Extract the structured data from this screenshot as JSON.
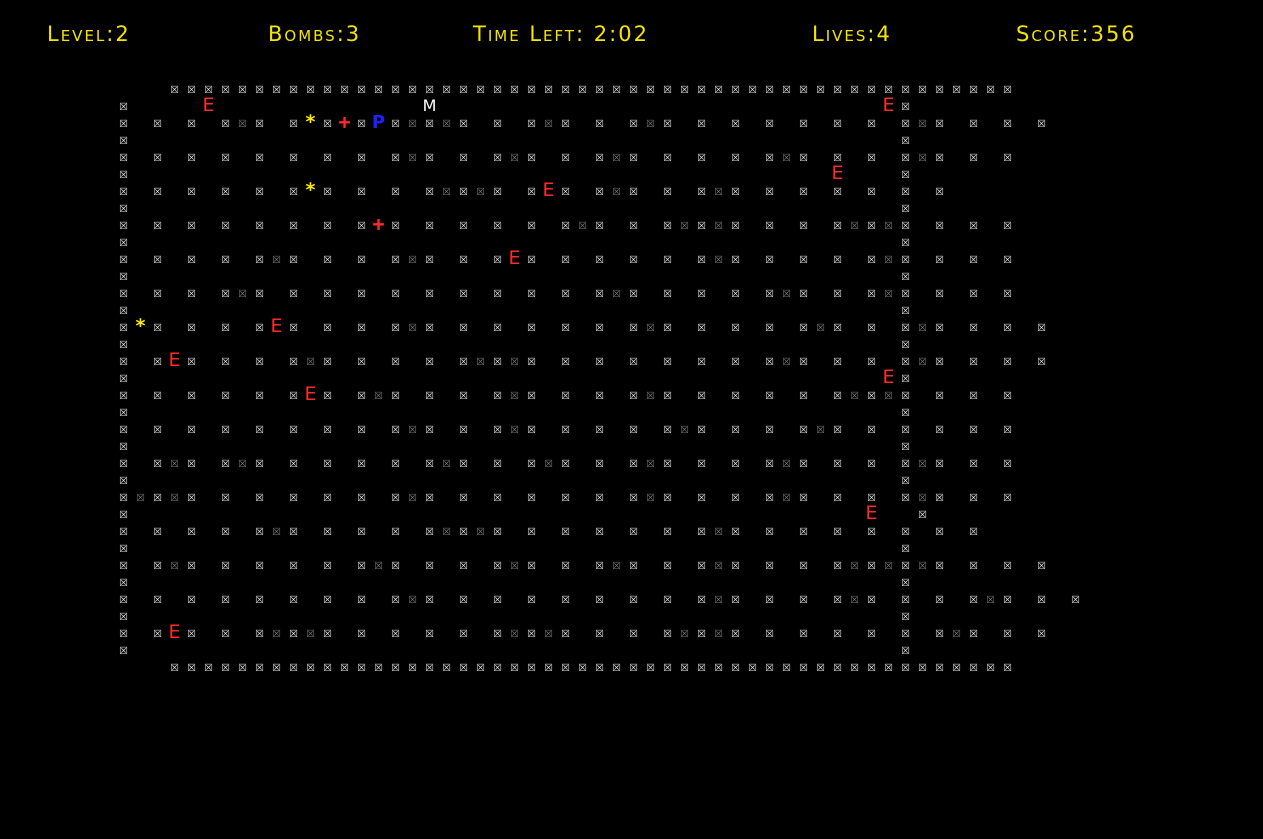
{
  "hud": {
    "level": "Level:2",
    "bombs": "Bombs:3",
    "time_left": "Time Left: 2:02",
    "lives": "Lives:4",
    "score": "Score:356"
  },
  "colors": {
    "background": "#000000",
    "hud_text": "#f5e400",
    "wall": "#e8e8e8",
    "soft_block": "#7a7a7a",
    "enemy": "#ff2a2a",
    "bonus": "#ffea00",
    "player": "#2020ff",
    "marker": "#ffffff"
  },
  "legend": {
    "wall": "☒",
    "soft": "☒",
    "enemy": "E",
    "bonus": "*",
    "health": "+",
    "player": "P",
    "marker": "M"
  },
  "maze": [
    "...##################################################",
    "#....E............M..........................E#",
    "#.#.#.#s#.#*#+#P#s#s#.#.#s#.#.#s#.#.#.#.#.#.#.#s#.#.#.#",
    "#.............................................#",
    "#.#.#.#.#.#.#.#.#s#.#.#s#.#.#s#.#.#.#.#s#.#.#.#s#.#.#",
    "#.........................................E...#",
    "#.#.#.#.#.#*#.#.#.#s#s#.#E#.#s#.#.#s#.#.#.#.#.#.#",
    "#.............................................#",
    "#.#.#.#.#.#.#.#+#.#.#.#.#.#s#.#.#s#s#.#.#.#s#s#.#.#.#",
    "#.............................................#",
    "#.#.#.#.#s#.#.#.#s#.#.#E#.#.#.#.#.#s#.#.#.#.#s#.#.#.#",
    "#.............................................#",
    "#.#.#.#s#.#.#.#.#.#.#.#.#.#.#s#.#.#.#.#s#.#.#s#.#.#.#",
    "#.............................................#",
    "#*#.#.#.#E#.#.#.#s#.#.#.#.#.#.#s#.#.#.#.#s#.#.#s#.#.#.#",
    "#.............................................#",
    "#.#E#.#.#.#s#.#.#.#.#s#s#.#.#.#.#.#.#.#s#.#.#.#s#.#.#.#",
    "#............................................E#",
    "#.#.#.#.#.#E#.#s#.#.#.#s#.#.#.#s#.#.#.#.#.#s#s#.#.#.#",
    "#.............................................#",
    "#.#.#.#.#.#.#.#.#s#.#.#s#.#.#.#.#s#.#.#.#s#.#.#.#.#.#",
    "#.............................................#",
    "#.#s#.#s#.#.#.#.#.#s#.#.#s#.#.#s#.#.#.#s#.#.#.#s#.#.#",
    "#.............................................#",
    "#s#s#.#.#.#.#.#.#s#.#.#.#.#.#.#s#.#.#.#s#.#.#.#s#.#.#",
    "#...........................................E..#",
    "#.#.#.#.#s#.#.#.#.#s#s#.#.#.#.#.#.#s#.#.#.#.#.#.#.#",
    "#.............................................#",
    "#.#s#.#.#.#.#.#s#.#.#.#s#.#.#s#.#.#s#.#.#.#s#s#s#.#.#.#",
    "#.............................................#",
    "#.#.#.#.#.#.#.#.#s#.#.#.#.#.#.#.#.#s#.#.#.#s#.#.#.#s#.#.#",
    "#.............................................#",
    "#.#E#.#.#s#s#.#.#.#.#.#s#s#.#.#.#s#s#.#.#.#.#.#.#s#.#.#",
    "#.............................................#",
    "...##################################################"
  ]
}
